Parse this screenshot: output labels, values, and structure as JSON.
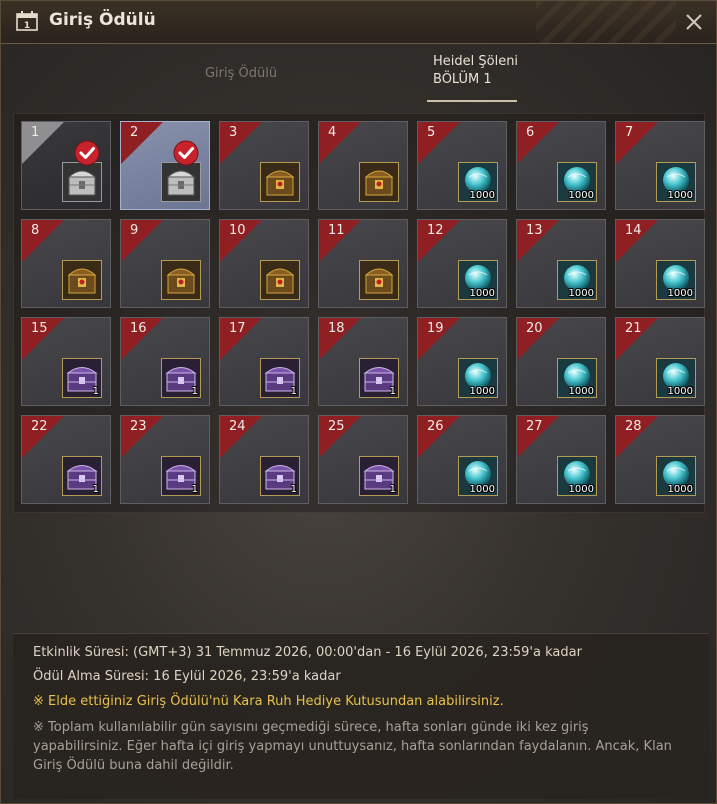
{
  "window": {
    "title": "Giriş Ödülü"
  },
  "tabs": {
    "login_reward": "Giriş Ödülü",
    "event_title": "Heidel Şöleni",
    "event_subtitle": "BÖLÜM 1"
  },
  "days": [
    {
      "day": "1",
      "item": "silver-chest",
      "qty": "",
      "claimed": true
    },
    {
      "day": "2",
      "item": "silver-chest",
      "qty": "",
      "claimed": true,
      "selected": true
    },
    {
      "day": "3",
      "item": "gold-chest",
      "qty": ""
    },
    {
      "day": "4",
      "item": "gold-chest",
      "qty": ""
    },
    {
      "day": "5",
      "item": "silver-gem",
      "qty": "1000"
    },
    {
      "day": "6",
      "item": "silver-gem",
      "qty": "1000"
    },
    {
      "day": "7",
      "item": "silver-gem",
      "qty": "1000"
    },
    {
      "day": "8",
      "item": "gold-chest",
      "qty": ""
    },
    {
      "day": "9",
      "item": "gold-chest",
      "qty": ""
    },
    {
      "day": "10",
      "item": "gold-chest",
      "qty": ""
    },
    {
      "day": "11",
      "item": "gold-chest",
      "qty": ""
    },
    {
      "day": "12",
      "item": "silver-gem",
      "qty": "1000"
    },
    {
      "day": "13",
      "item": "silver-gem",
      "qty": "1000"
    },
    {
      "day": "14",
      "item": "silver-gem",
      "qty": "1000"
    },
    {
      "day": "15",
      "item": "purple-chest",
      "qty": "1"
    },
    {
      "day": "16",
      "item": "purple-chest",
      "qty": "1"
    },
    {
      "day": "17",
      "item": "purple-chest",
      "qty": "1"
    },
    {
      "day": "18",
      "item": "purple-chest",
      "qty": "1"
    },
    {
      "day": "19",
      "item": "silver-gem",
      "qty": "1000"
    },
    {
      "day": "20",
      "item": "silver-gem",
      "qty": "1000"
    },
    {
      "day": "21",
      "item": "silver-gem",
      "qty": "1000"
    },
    {
      "day": "22",
      "item": "purple-chest",
      "qty": "1"
    },
    {
      "day": "23",
      "item": "purple-chest",
      "qty": "1"
    },
    {
      "day": "24",
      "item": "purple-chest",
      "qty": "1"
    },
    {
      "day": "25",
      "item": "purple-chest",
      "qty": "1"
    },
    {
      "day": "26",
      "item": "silver-gem",
      "qty": "1000"
    },
    {
      "day": "27",
      "item": "silver-gem",
      "qty": "1000"
    },
    {
      "day": "28",
      "item": "silver-gem",
      "qty": "1000"
    }
  ],
  "info": {
    "event_period": "Etkinlik Süresi: (GMT+3) 31 Temmuz 2026, 00:00'dan - 16 Eylül 2026, 23:59'a kadar",
    "claim_period": "Ödül Alma Süresi: 16 Eylül 2026, 23:59'a kadar",
    "notice": "※ Elde ettiğiniz Giriş Ödülü'nü Kara Ruh Hediye Kutusundan alabilirsiniz.",
    "weekend_note": "※ Toplam kullanılabilir gün sayısını geçmediği sürece, hafta sonları günde iki kez giriş yapabilirsiniz. Eğer hafta içi giriş yapmayı unuttuysanız, hafta sonlarından faydalanın. Ancak, Klan Giriş Ödülü buna dahil değildir."
  },
  "colors": {
    "corner_red": "#8f1f22",
    "notice_yellow": "#e8c04a",
    "selected_blue": "#8892ad"
  }
}
